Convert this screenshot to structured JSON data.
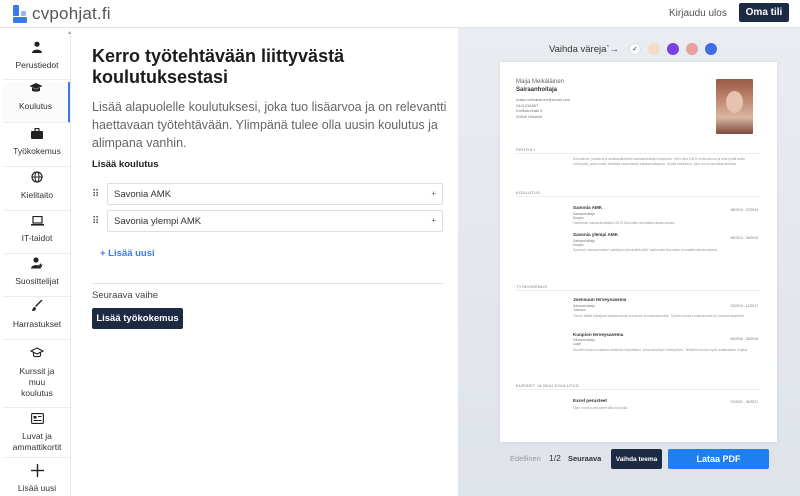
{
  "header": {
    "brand": "cvpohjat.fi",
    "logout": "Kirjaudu ulos",
    "account": "Oma tili"
  },
  "sidebar": {
    "items": [
      {
        "label": "Perustiedot",
        "icon": "person-icon"
      },
      {
        "label": "Koulutus",
        "icon": "graduation-cap-icon",
        "active": true
      },
      {
        "label": "Työkokemus",
        "icon": "briefcase-icon"
      },
      {
        "label": "Kielitaito",
        "icon": "globe-icon"
      },
      {
        "label": "IT-taidot",
        "icon": "laptop-icon"
      },
      {
        "label": "Suosittelijat",
        "icon": "user-star-icon"
      },
      {
        "label": "Harrastukset",
        "icon": "paintbrush-icon"
      },
      {
        "label": "Kurssit ja muu koulutus",
        "icon": "mortarboard-outline-icon"
      },
      {
        "label": "Luvat ja ammattikortit",
        "icon": "id-card-icon"
      },
      {
        "label": "Lisää uusi",
        "icon": "plus-icon"
      }
    ]
  },
  "main": {
    "title": "Kerro työtehtävään liittyvästä koulutuksestasi",
    "lead": "Lisää alapuolelle koulutuksesi, joka tuo lisäarvoa ja on relevantti haettavaan työtehtävään. Ylimpänä tulee olla uusin koulutus ja alimpana vanhin.",
    "add_heading": "Lisää koulutus",
    "educations": [
      "Savonia AMK",
      "Savonia ylempi AMK"
    ],
    "add_new": "+ Lisää uusi",
    "next_heading": "Seuraava vaihe",
    "next_button": "Lisää työkokemus"
  },
  "preview": {
    "color_label": "Vaihda väreja`→",
    "swatches": [
      "#ffffff",
      "#f3dcc8",
      "#7b3fe4",
      "#e8a0a0",
      "#3c6fe6"
    ],
    "cv": {
      "name": "Maija Meikäläinen",
      "job": "Sairaanhoitaja",
      "contact": [
        "maija.meikalainen@email.com",
        "0441234567",
        "Kotikatu/katu 5",
        "00540 Helsinki"
      ],
      "sec_profile": "PROFIILI",
      "profile_text": "Kokotunne, joustava ja asiakaslähtöinen sairaanhoitaja Kuopiosta. Olen ollut 100% motivoitunut ja tulla työllä uutta hoitotyötä, jossa voisin kehittää osaamistani sairaanhoitajana. Hyvää tutkintoon, joka voi tuoda asiaa tiedetta.",
      "sec_education": "KOULUTUS",
      "edu": [
        {
          "title": "Savonia AMK",
          "sub": "Sairaanhoitaja\nKuopio",
          "desc": "Valmistuin sairaanhoitajaksi 2013 Savonian ammattikorkeakoulusta.",
          "date": "08/2010 - 07/2013"
        },
        {
          "title": "Savonia ylempi AMK",
          "sub": "Sairaanhoitaja\nKuopio",
          "desc": "Syvensin sairaanhoidon opintojani ylemmällä AMK tutkinnolla Savonian ammattikorkeakoulussa.",
          "date": "08/2013 - 06/2015"
        }
      ],
      "sec_work": "TYÖKOKEMUS",
      "work": [
        {
          "title": "Joensuun terveysasema",
          "sub": "Sairaanhoitaja\nJoensuu",
          "desc": "Toimin täällä hoitajana vastaanotolla Joensuun terveysasemalla. Työhön kuului kuvantaminen ja hoitotoimenpiteet.",
          "date": "03/2015 - 12/2017"
        },
        {
          "title": "Kuopion terveysasema",
          "sub": "Sairaanhoitaja\nLapin",
          "desc": "Suoritin kuusi kuukautta kestävän harjoittelun, jossa keskityin hoitotyöhön. Tehtäviin kuului myös asiakkaiden ohjaus.",
          "date": "06/2016 - 05/2018"
        }
      ],
      "sec_courses": "KURSSIT JA MUU KOULUTUS",
      "course": {
        "title": "Excel perusteet",
        "desc": "Opin excelin perusteet tällä kurssilla.",
        "date": "07/2021 - 08/2021"
      }
    },
    "pager": {
      "prev": "Edellinen",
      "page": "1/2",
      "next": "Seuraava"
    },
    "theme_button": "Vaihda teema",
    "pdf_button": "Lataa PDF"
  }
}
